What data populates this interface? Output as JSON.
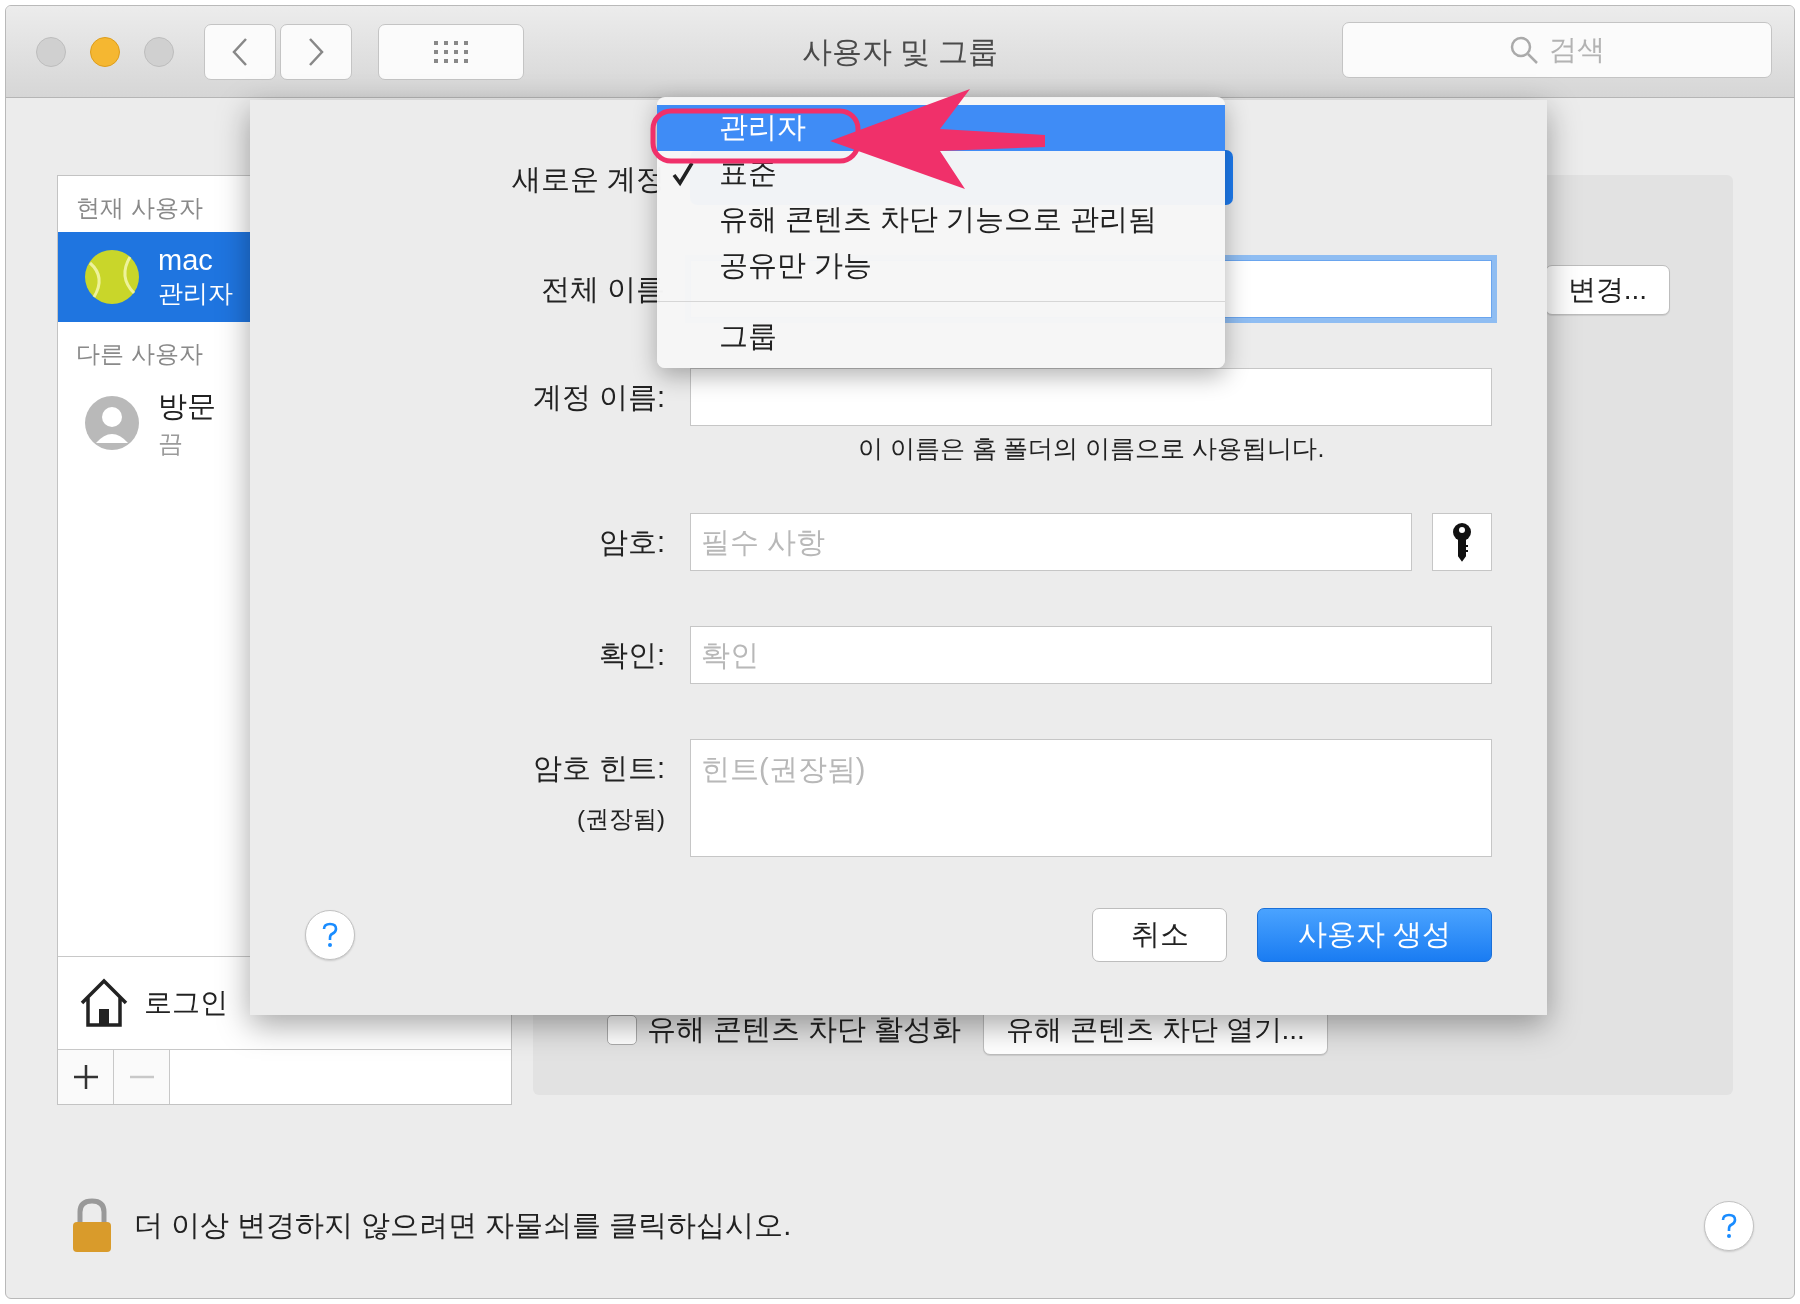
{
  "window": {
    "title": "사용자 및 그룹"
  },
  "toolbar": {
    "search": {
      "placeholder": "검색"
    }
  },
  "sidebar": {
    "sections": [
      {
        "header": "현재 사용자",
        "users": [
          {
            "name": "mac",
            "role": "관리자",
            "selected": true,
            "kind": "ball"
          }
        ]
      },
      {
        "header": "다른 사용자",
        "users": [
          {
            "name": "방문",
            "role": "끔",
            "selected": false,
            "kind": "silhouette"
          }
        ]
      }
    ],
    "login_options": "로그인"
  },
  "main": {
    "change_button": "변경...",
    "parental_checkbox": {
      "label": "유해 콘텐츠 차단 활성화",
      "checked": false
    },
    "parental_button": "유해 콘텐츠 차단 열기..."
  },
  "sheet": {
    "rows": [
      {
        "kind": "popup",
        "label": "새로운 계정"
      },
      {
        "kind": "text",
        "label": "전체 이름",
        "focused": true
      },
      {
        "kind": "text",
        "label": "계정 이름:",
        "focused": false
      },
      {
        "kind": "note",
        "text": "이 이름은 홈 폴더의 이름으로 사용됩니다."
      },
      {
        "kind": "password",
        "label": "암호:",
        "placeholder": "필수 사항",
        "focused": false
      },
      {
        "kind": "text",
        "label": "확인:",
        "placeholder": "확인",
        "focused": false
      },
      {
        "kind": "textarea",
        "label": "암호 힌트:",
        "sublabel": "(권장됨)",
        "placeholder": "힌트(권장됨)",
        "focused": false
      }
    ],
    "buttons": [
      {
        "label": "취소",
        "kind": "default"
      },
      {
        "label": "사용자 생성",
        "kind": "primary"
      }
    ]
  },
  "menu": {
    "items": [
      {
        "kind": "item",
        "label": "관리자",
        "selected": true,
        "checked": false
      },
      {
        "kind": "item",
        "label": "표준",
        "selected": false,
        "checked": true
      },
      {
        "kind": "item",
        "label": "유해 콘텐츠 차단 기능으로 관리됨",
        "selected": false,
        "checked": false
      },
      {
        "kind": "item",
        "label": "공유만 가능",
        "selected": false,
        "checked": false
      },
      {
        "kind": "separator"
      },
      {
        "kind": "item",
        "label": "그룹",
        "selected": false,
        "checked": false
      }
    ]
  },
  "footer": {
    "lock_text": "더 이상 변경하지 않으려면 자물쇠를 클릭하십시오."
  }
}
